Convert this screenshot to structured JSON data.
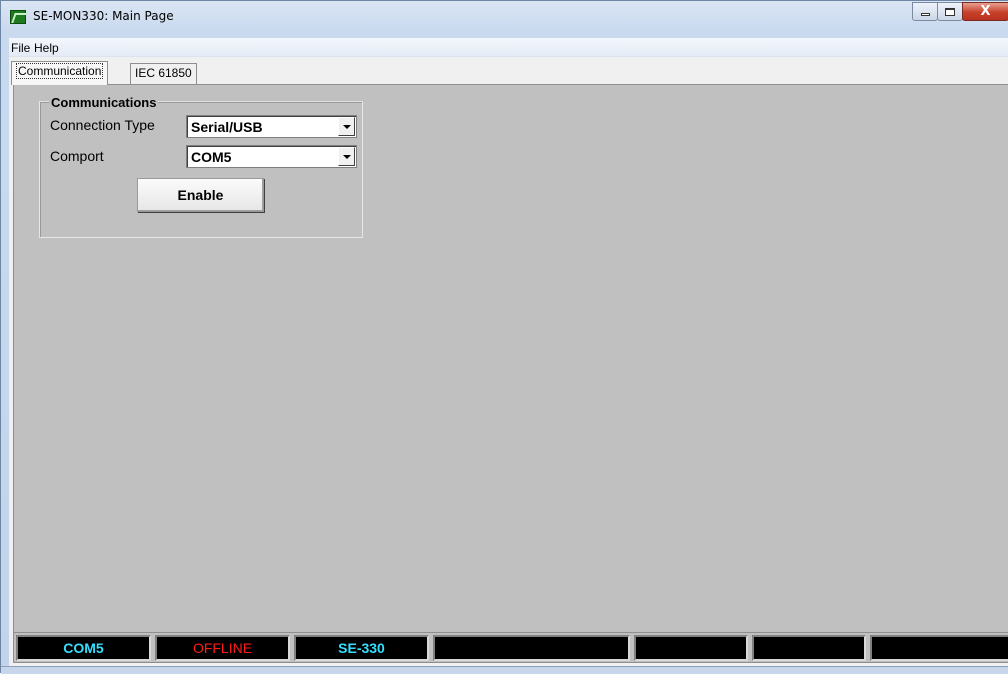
{
  "window": {
    "title": "SE-MON330: Main Page",
    "app_icon": "semon-app-icon",
    "caption_buttons": {
      "minimize": "minimize-icon",
      "maximize": "maximize-icon",
      "close": "X"
    }
  },
  "menu": {
    "items": [
      {
        "label": "File"
      },
      {
        "label": "Help"
      }
    ]
  },
  "tabs": [
    {
      "label": "Communication",
      "active": true
    },
    {
      "label": "IEC 61850",
      "active": false
    }
  ],
  "communications": {
    "group_title": "Communications",
    "connection_type": {
      "label": "Connection Type",
      "value": "Serial/USB"
    },
    "comport": {
      "label": "Comport",
      "value": "COM5"
    },
    "enable_button": "Enable"
  },
  "statusbar": {
    "panels": [
      {
        "text": "COM5",
        "color": "#33dfff"
      },
      {
        "text": "OFFLINE",
        "color": "#ff1a1a"
      },
      {
        "text": "SE-330",
        "color": "#33dfff"
      },
      {
        "text": ""
      },
      {
        "text": ""
      },
      {
        "text": ""
      },
      {
        "text": ""
      }
    ]
  },
  "colors": {
    "tab_page_background": "#c0c0c0",
    "status_panel_background": "#000000"
  }
}
